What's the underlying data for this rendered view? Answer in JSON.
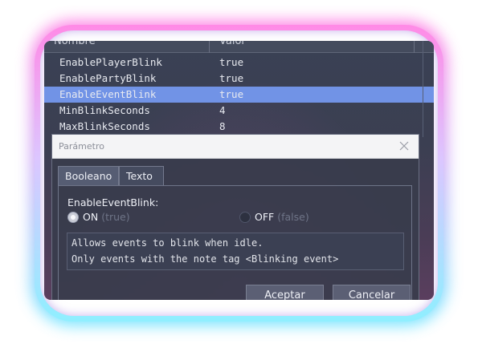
{
  "table": {
    "col_name": "Nombre",
    "col_value": "Valor",
    "rows": [
      {
        "key": "EnablePlayerBlink",
        "value": "true",
        "selected": false
      },
      {
        "key": "EnablePartyBlink",
        "value": "true",
        "selected": false
      },
      {
        "key": "EnableEventBlink",
        "value": "true",
        "selected": true
      },
      {
        "key": "MinBlinkSeconds",
        "value": "4",
        "selected": false
      },
      {
        "key": "MaxBlinkSeconds",
        "value": "8",
        "selected": false
      }
    ]
  },
  "dialog": {
    "title": "Parámetro",
    "close_icon": "close-icon",
    "tabs": [
      {
        "label": "Booleano",
        "active": true
      },
      {
        "label": "Texto",
        "active": false
      }
    ],
    "param_label": "EnableEventBlink:",
    "radio_on": {
      "label": "ON",
      "hint": "(true)",
      "checked": true
    },
    "radio_off": {
      "label": "OFF",
      "hint": "(false)",
      "checked": false
    },
    "description": [
      "Allows events to blink when idle.",
      "Only events with the note tag <Blinking event>"
    ],
    "ok_label": "Aceptar",
    "cancel_label": "Cancelar"
  },
  "colors": {
    "selection": "#7193e6",
    "frame_top": "#ff6fe0",
    "frame_bottom": "#5ee2ff"
  }
}
